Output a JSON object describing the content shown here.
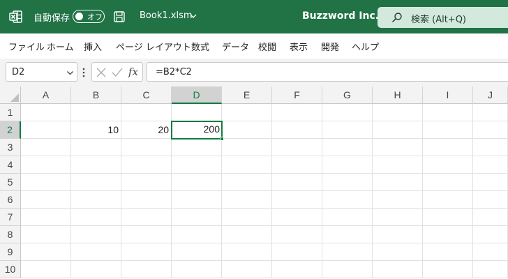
{
  "titlebar": {
    "autosave_label": "自動保存",
    "autosave_state": "オフ",
    "filename": "Book1.xlsm",
    "company": "Buzzword Inc.",
    "search_placeholder": "検索 (Alt+Q)",
    "color": "#217346"
  },
  "menu": [
    "ファイル",
    "ホーム",
    "挿入",
    "ページ レイアウト",
    "数式",
    "データ",
    "校閲",
    "表示",
    "開発",
    "ヘルプ"
  ],
  "formula_bar": {
    "name_box": "D2",
    "fx_label": "fx",
    "formula": "=B2*C2"
  },
  "sheet": {
    "columns": [
      "A",
      "B",
      "C",
      "D",
      "E",
      "F",
      "G",
      "H",
      "I",
      "J"
    ],
    "rows": [
      "1",
      "2",
      "3",
      "4",
      "5",
      "6",
      "7",
      "8",
      "9",
      "10"
    ],
    "selected_column": "D",
    "selected_row": "2",
    "cells": {
      "B2": "10",
      "C2": "20",
      "D2": "200"
    },
    "accent_color": "#107c41"
  }
}
